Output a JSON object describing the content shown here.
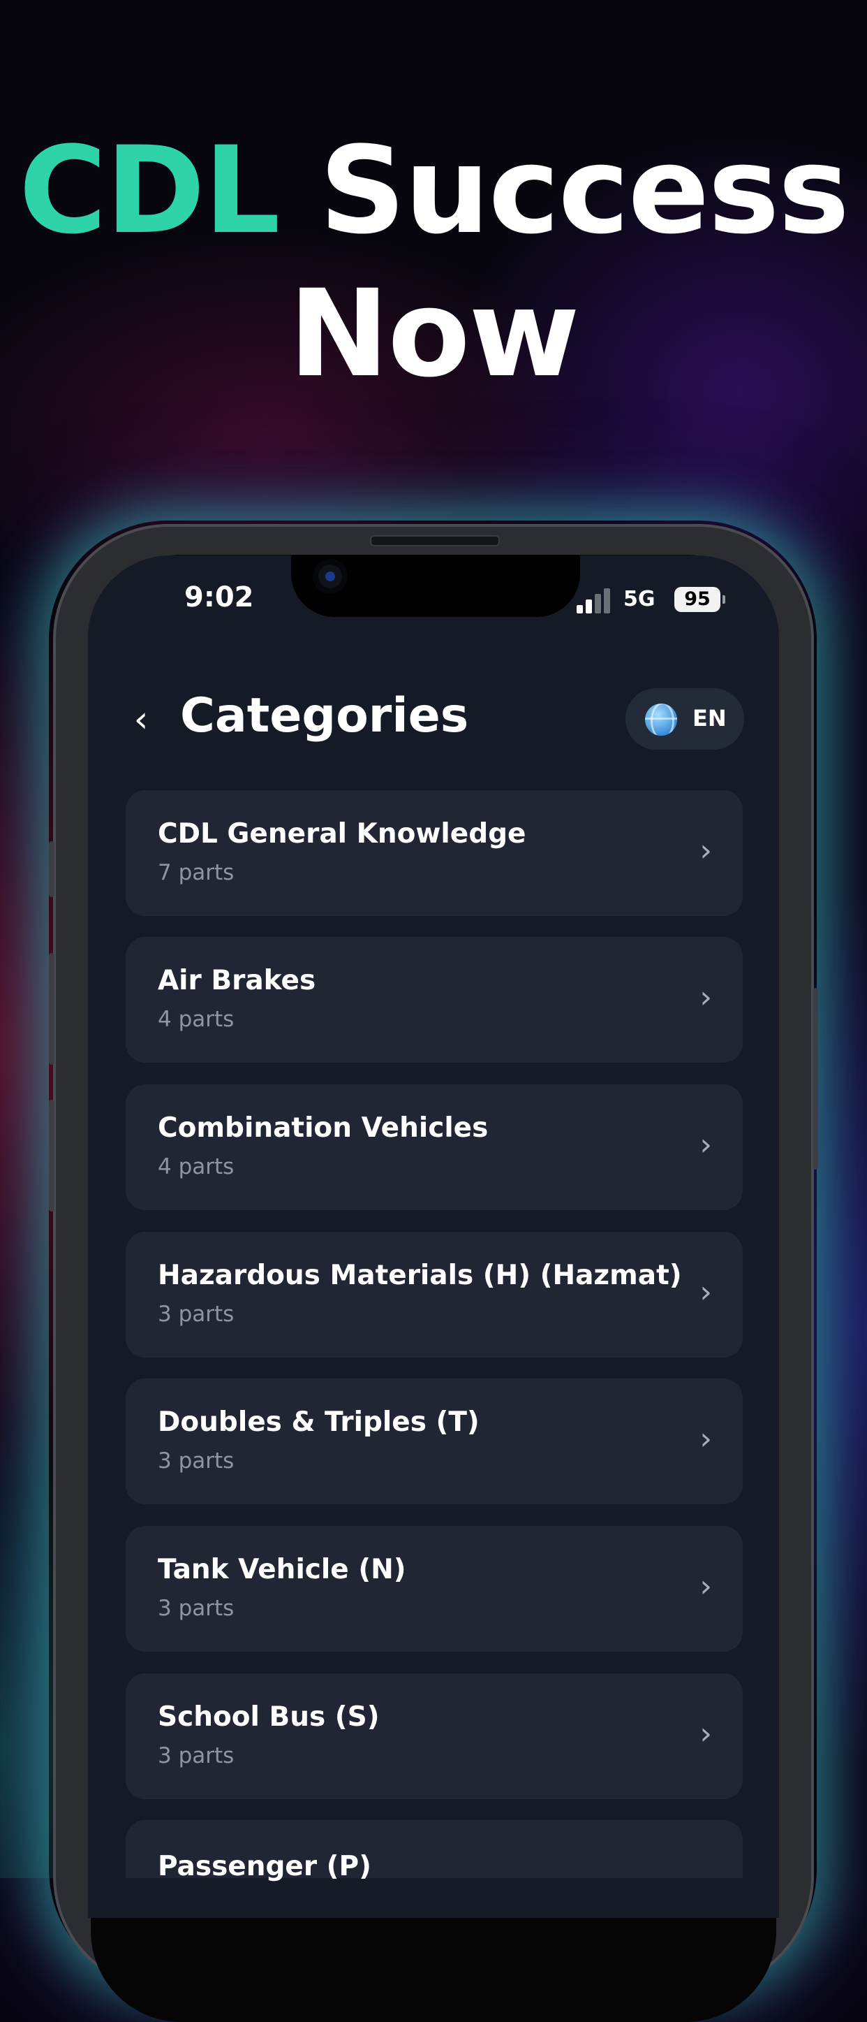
{
  "headline": {
    "accent": "CDL",
    "line1_rest": " Success",
    "line2": "Now"
  },
  "status_bar": {
    "time": "9:02",
    "network": "5G",
    "battery": "95"
  },
  "header": {
    "back_glyph": "‹",
    "title": "Categories",
    "language": "EN",
    "language_icon": "globe-icon"
  },
  "categories": [
    {
      "title": "CDL General Knowledge",
      "subtitle": "7 parts"
    },
    {
      "title": "Air Brakes",
      "subtitle": "4 parts"
    },
    {
      "title": "Combination Vehicles",
      "subtitle": "4 parts"
    },
    {
      "title": "Hazardous Materials (H) (Hazmat)",
      "subtitle": "3 parts"
    },
    {
      "title": "Doubles & Triples (T)",
      "subtitle": "3 parts"
    },
    {
      "title": "Tank Vehicle (N)",
      "subtitle": "3 parts"
    },
    {
      "title": "School Bus (S)",
      "subtitle": "3 parts"
    },
    {
      "title": "Passenger (P)",
      "subtitle": ""
    }
  ],
  "colors": {
    "accent": "#2fd3a8",
    "card": "#202633",
    "screen": "#151b26"
  }
}
